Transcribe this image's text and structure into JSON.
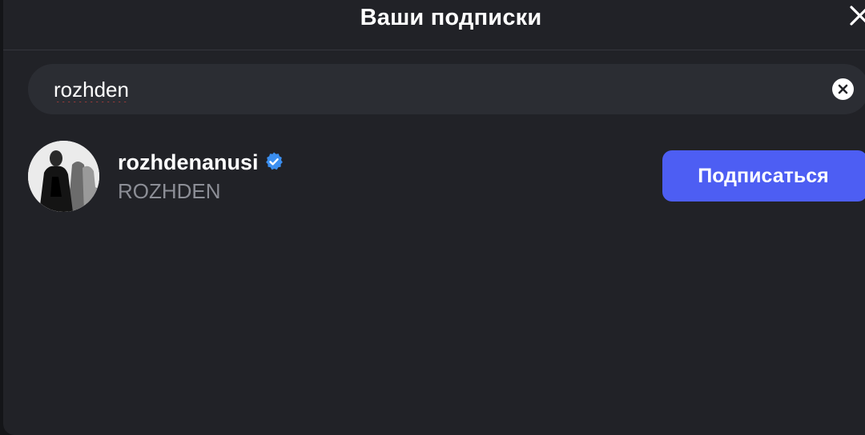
{
  "header": {
    "title": "Ваши подписки",
    "close_icon": "close-icon"
  },
  "search": {
    "value": "rozhden",
    "placeholder": "",
    "clear_icon": "clear-search-icon"
  },
  "results": [
    {
      "username": "rozhdenanusi",
      "verified": true,
      "display_name": "ROZHDEN",
      "action_label": "Подписаться"
    }
  ],
  "colors": {
    "background": "#212227",
    "search_background": "#2b2d33",
    "accent": "#4d5ef3",
    "verified": "#3b8ff0",
    "secondary_text": "#8c8e96"
  }
}
